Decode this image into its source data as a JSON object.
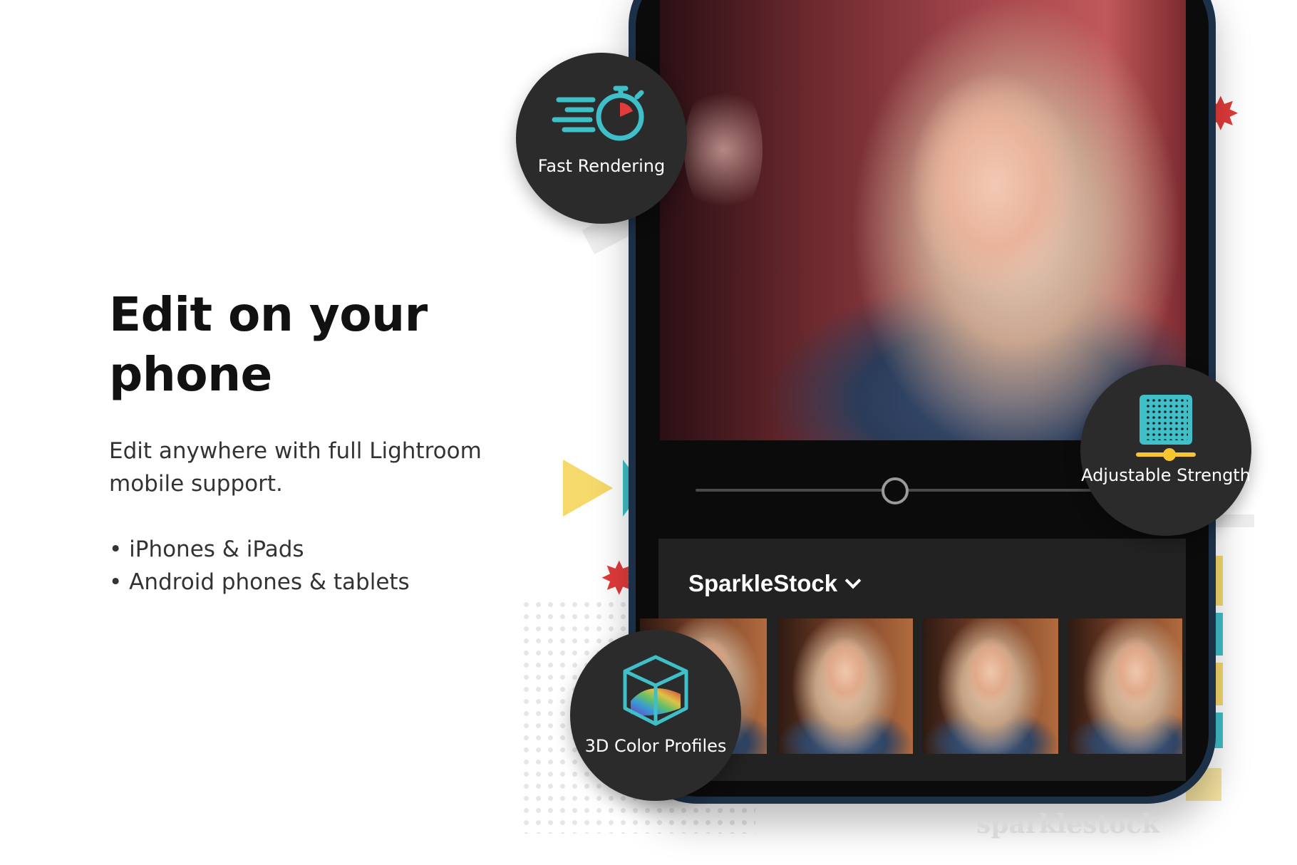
{
  "headline": "Edit on your phone",
  "subtext": "Edit anywhere with full Lightroom mobile support.",
  "bullets": [
    "• iPhones & iPads",
    "• Android phones & tablets"
  ],
  "phone_screen": {
    "slider_level": 0.5,
    "preset_group": "SparkleStock"
  },
  "features": [
    {
      "label": "Fast Rendering",
      "icon": "stopwatch-speed-icon"
    },
    {
      "label": "Adjustable Strength",
      "icon": "slider-pattern-icon"
    },
    {
      "label": "3D Color Profiles",
      "icon": "color-cube-icon"
    }
  ],
  "watermark": "sparklestock",
  "colors": {
    "accent_teal": "#3fc0c9",
    "accent_yellow": "#f6d96b",
    "accent_red": "#e23b3b",
    "bubble_bg": "#2b2b2b",
    "phone_frame": "#1c3048"
  }
}
